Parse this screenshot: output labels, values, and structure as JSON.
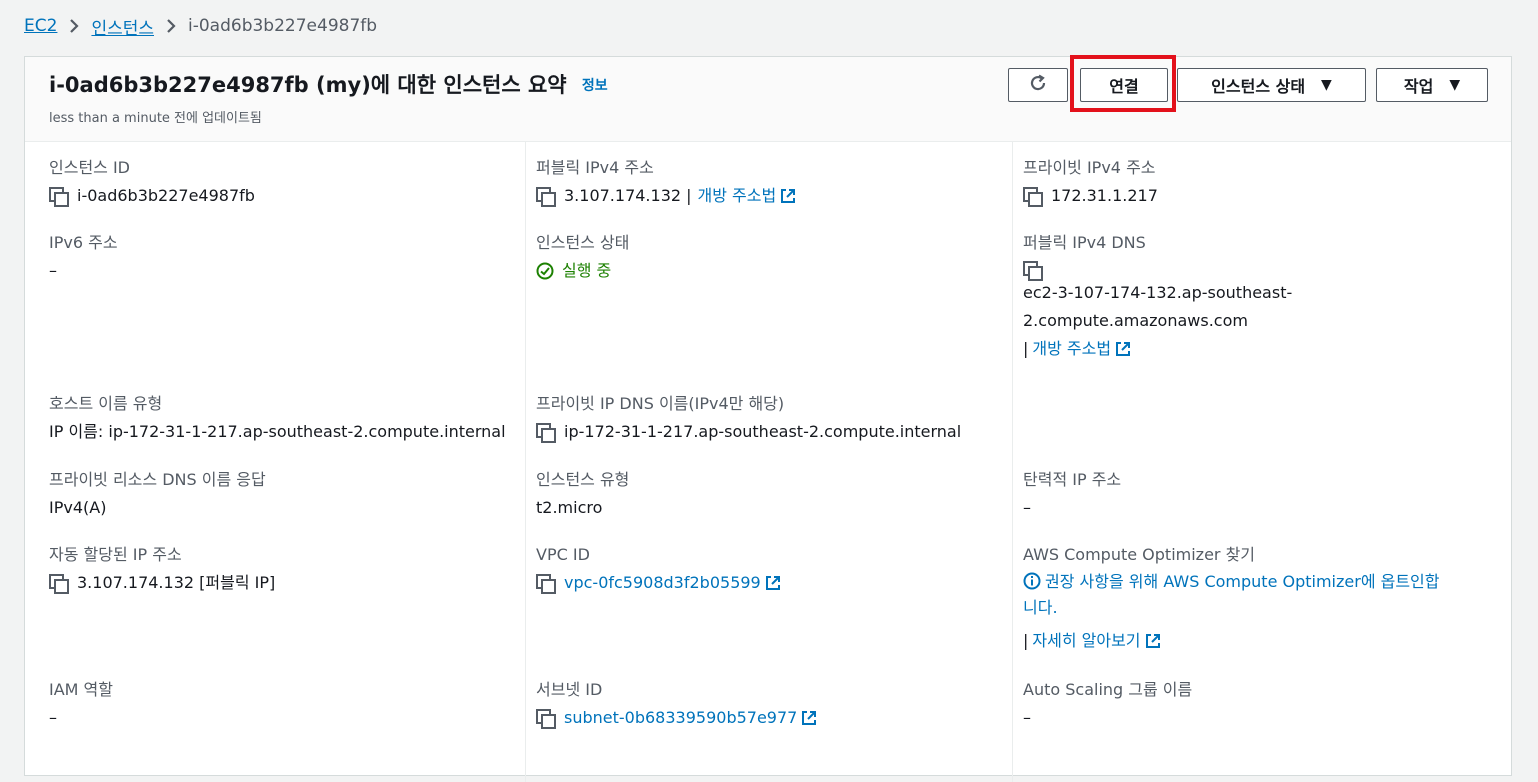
{
  "breadcrumb": {
    "root": "EC2",
    "parent": "인스턴스",
    "current": "i-0ad6b3b227e4987fb"
  },
  "header": {
    "title": "i-0ad6b3b227e4987fb (my)에 대한 인스턴스 요약",
    "info_link": "정보",
    "updated": "less than a minute 전에 업데이트됨",
    "connect_label": "연결",
    "instance_state_label": "인스턴스 상태",
    "actions_label": "작업"
  },
  "fields": {
    "instance_id_label": "인스턴스 ID",
    "instance_id": "i-0ad6b3b227e4987fb",
    "public_ipv4_label": "퍼블릭 IPv4 주소",
    "public_ipv4": "3.107.174.132 |",
    "open_address_link": "개방 주소법",
    "private_ipv4_label": "프라이빗 IPv4 주소",
    "private_ipv4": "172.31.1.217",
    "ipv6_label": "IPv6 주소",
    "ipv6": "–",
    "instance_state_label": "인스턴스 상태",
    "instance_state": "실행 중",
    "public_dns_label": "퍼블릭 IPv4 DNS",
    "public_dns_line1": "ec2-3-107-174-132.ap-southeast-",
    "public_dns_line2": "2.compute.amazonaws.com",
    "public_dns_bar": "|",
    "public_dns_link": "개방 주소법",
    "hostname_type_label": "호스트 이름 유형",
    "hostname_type": "IP 이름: ip-172-31-1-217.ap-southeast-2.compute.internal",
    "private_dns_label": "프라이빗 IP DNS 이름(IPv4만 해당)",
    "private_dns": "ip-172-31-1-217.ap-southeast-2.compute.internal",
    "resource_dns_label": "프라이빗 리소스 DNS 이름 응답",
    "resource_dns": "IPv4(A)",
    "instance_type_label": "인스턴스 유형",
    "instance_type": "t2.micro",
    "elastic_ip_label": "탄력적 IP 주소",
    "elastic_ip": "–",
    "auto_ip_label": "자동 할당된 IP 주소",
    "auto_ip": "3.107.174.132 [퍼블릭 IP]",
    "vpc_label": "VPC ID",
    "vpc": "vpc-0fc5908d3f2b05599",
    "optimizer_label": "AWS Compute Optimizer 찾기",
    "optimizer_text_a": "권장 사항을 위해 ",
    "optimizer_text_link": "AWS Compute Optimizer",
    "optimizer_text_b": "에 옵트인합",
    "optimizer_text_c": "니다.",
    "optimizer_bar": "|",
    "optimizer_more": "자세히 알아보기",
    "iam_label": "IAM 역할",
    "iam": "–",
    "subnet_label": "서브넷 ID",
    "subnet": "subnet-0b68339590b57e977",
    "asg_label": "Auto Scaling 그룹 이름",
    "asg": "–"
  },
  "colors": {
    "link": "#0073bb",
    "success": "#1d8102",
    "highlight": "#e3111b"
  }
}
